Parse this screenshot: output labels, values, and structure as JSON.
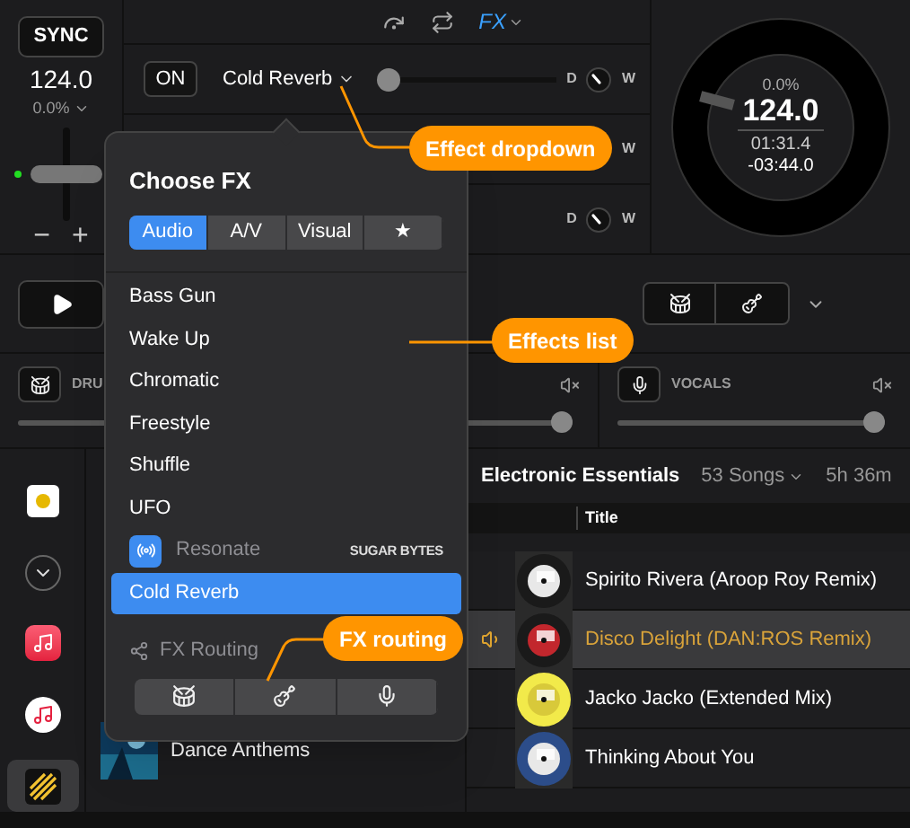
{
  "deck": {
    "sync": "SYNC",
    "bpm": "124.0",
    "pitch": "0.0%",
    "minus": "−",
    "plus": "+",
    "pitch_slider": {
      "level": 0.5
    }
  },
  "toolbar": {
    "fx": "FX"
  },
  "fx_rows": [
    {
      "button": "ON",
      "effect": "Cold Reverb",
      "dry": "D",
      "wet": "W",
      "level": 0
    },
    {
      "wet": "W"
    },
    {
      "dry": "D",
      "wet": "W"
    }
  ],
  "jog": {
    "pitch": "0.0%",
    "bpm": "124.0",
    "elapsed": "01:31.4",
    "remaining": "-03:44.0"
  },
  "stems": [
    {
      "label": "DRU",
      "kind": "drums",
      "level": 1
    },
    {
      "label": "VOCALS",
      "kind": "vocals",
      "level": 1
    }
  ],
  "sidebar": {
    "items": [
      {
        "kind": "deck",
        "selected": false
      },
      {
        "kind": "expand",
        "selected": false
      },
      {
        "kind": "music-app",
        "selected": false
      },
      {
        "kind": "itunes",
        "selected": false
      },
      {
        "kind": "stripes",
        "selected": true
      }
    ]
  },
  "playlists": [
    {
      "name": "Dance Anthems"
    }
  ],
  "tracklist": {
    "title": "Electronic Essentials",
    "count": "53 Songs",
    "duration": "5h 36m",
    "columns": [
      "Title"
    ],
    "rows": [
      {
        "title": "Spirito Rivera (Aroop Roy Remix)",
        "playing": false
      },
      {
        "title": "Disco Delight (DAN:ROS Remix)",
        "playing": true
      },
      {
        "title": "Jacko Jacko (Extended Mix)",
        "playing": false
      },
      {
        "title": "Thinking About You",
        "playing": false
      }
    ]
  },
  "fx_popup": {
    "title": "Choose FX",
    "tabs": [
      {
        "label": "Audio",
        "selected": true
      },
      {
        "label": "A/V",
        "selected": false
      },
      {
        "label": "Visual",
        "selected": false
      },
      {
        "label": "★",
        "selected": false
      }
    ],
    "effects": [
      {
        "name": "Bass Gun",
        "kind": "plain",
        "selected": false
      },
      {
        "name": "Wake Up",
        "kind": "plain",
        "selected": false
      },
      {
        "name": "Chromatic",
        "kind": "plain",
        "selected": false
      },
      {
        "name": "Freestyle",
        "kind": "plain",
        "selected": false
      },
      {
        "name": "Shuffle",
        "kind": "plain",
        "selected": false
      },
      {
        "name": "UFO",
        "kind": "plain",
        "selected": false
      },
      {
        "name": "Resonate",
        "kind": "plugin",
        "vendor": "SUGAR BYTES",
        "disabled": true,
        "selected": false
      },
      {
        "name": "Cold Reverb",
        "kind": "plain",
        "selected": true
      }
    ],
    "routing": {
      "title": "FX Routing",
      "buttons": [
        {
          "kind": "drums"
        },
        {
          "kind": "instruments"
        },
        {
          "kind": "vocals"
        }
      ]
    }
  },
  "callouts": [
    {
      "text": "Effect dropdown"
    },
    {
      "text": "Effects list"
    },
    {
      "text": "FX routing"
    }
  ]
}
